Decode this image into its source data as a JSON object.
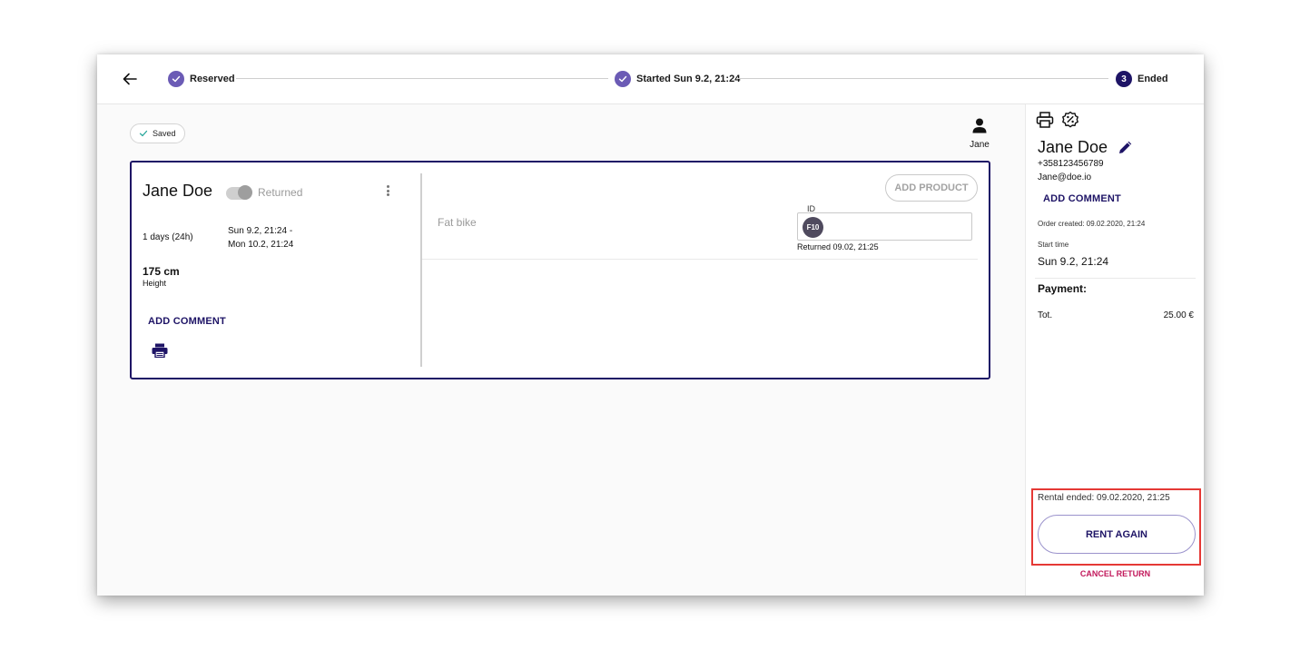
{
  "stepper": {
    "steps": [
      {
        "label": "Reserved",
        "state": "done"
      },
      {
        "label": "Started Sun 9.2, 21:24",
        "state": "done"
      },
      {
        "label": "Ended",
        "state": "current",
        "number": "3"
      }
    ]
  },
  "status": {
    "saved_label": "Saved"
  },
  "user": {
    "name": "Jane"
  },
  "rental": {
    "customer_name": "Jane Doe",
    "toggle_label": "Returned",
    "duration": "1 days (24h)",
    "start": "Sun 9.2, 21:24 -",
    "end": "Mon 10.2, 21:24",
    "height_value": "175 cm",
    "height_label": "Height",
    "add_comment": "ADD COMMENT",
    "add_product": "ADD PRODUCT",
    "product": {
      "name": "Fat bike",
      "id_label": "ID",
      "id_value": "F10",
      "returned_at": "Returned 09.02, 21:25"
    }
  },
  "panel": {
    "name": "Jane Doe",
    "phone": "+358123456789",
    "email": "Jane@doe.io",
    "add_comment": "ADD COMMENT",
    "order_created": "Order created: 09.02.2020, 21:24",
    "start_time_label": "Start time",
    "start_time": "Sun 9.2, 21:24",
    "payment_label": "Payment:",
    "total_label": "Tot.",
    "total_amount": "25.00 €",
    "rental_ended": "Rental ended: 09.02.2020, 21:25",
    "rent_again": "RENT AGAIN",
    "cancel_return": "CANCEL RETURN"
  },
  "colors": {
    "primary": "#1e1466",
    "step_done": "#6b5bb5",
    "cancel": "#c2185b",
    "highlight": "#e53935"
  }
}
